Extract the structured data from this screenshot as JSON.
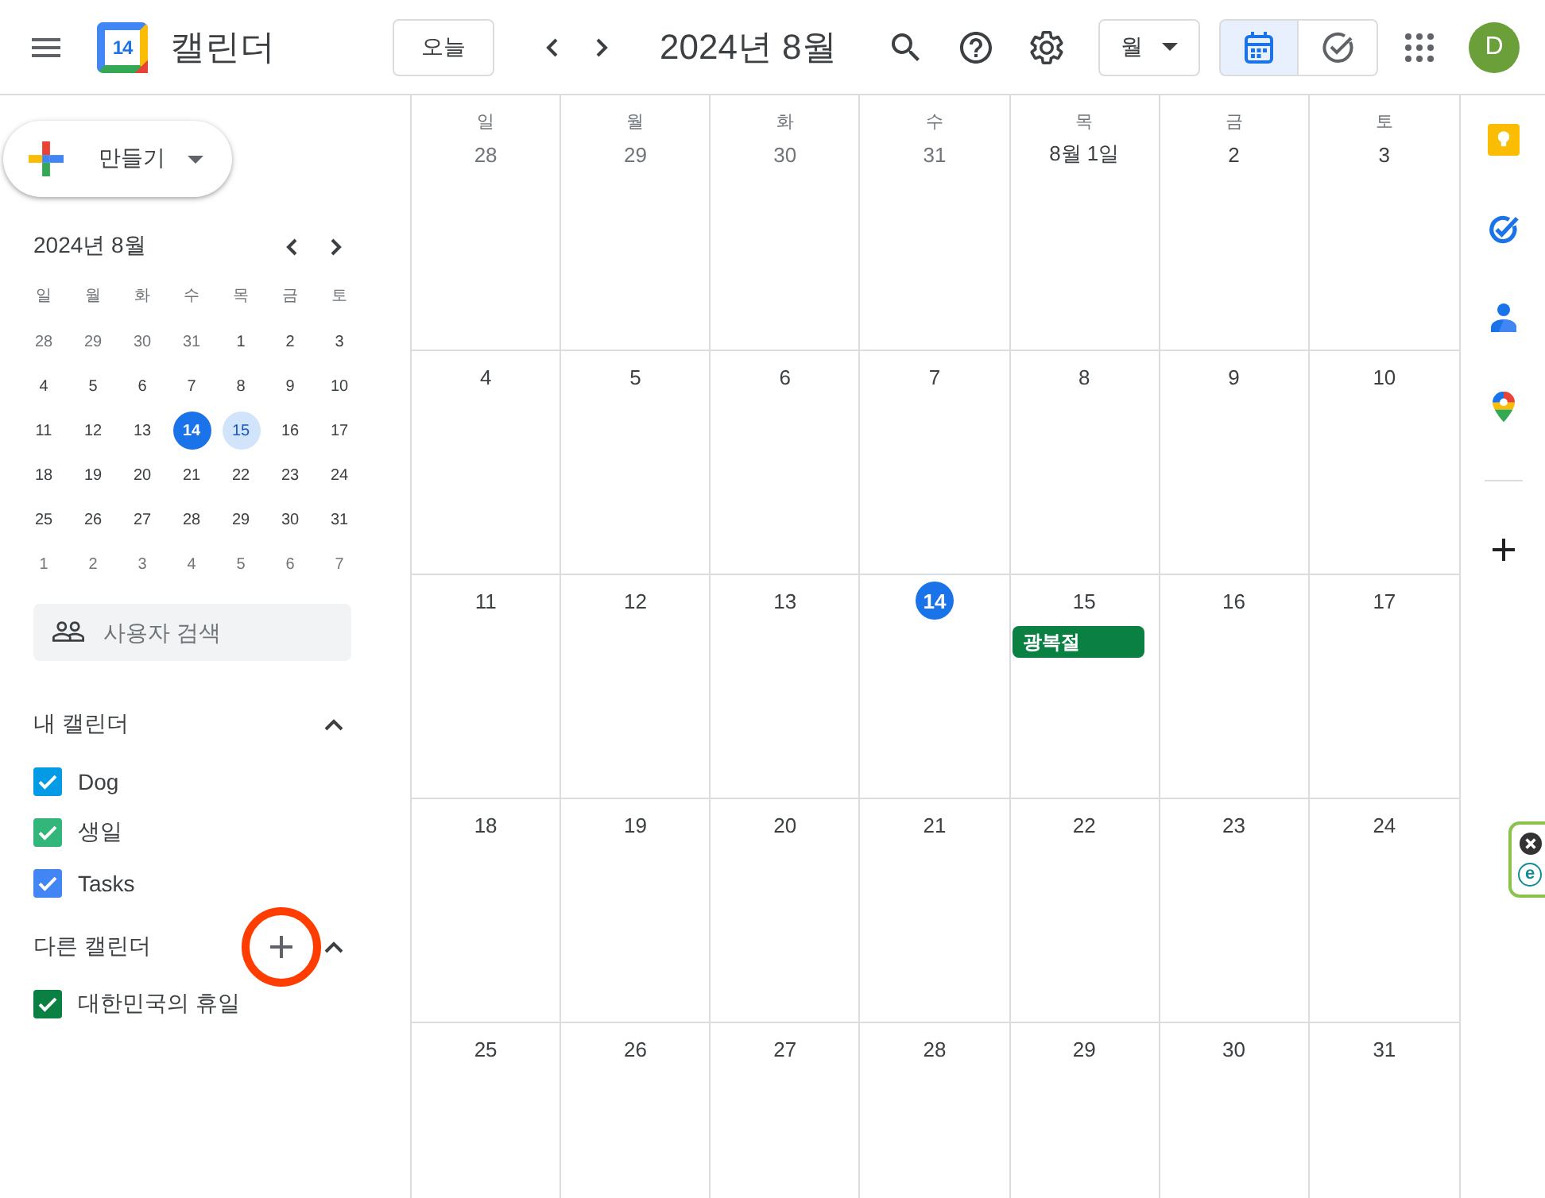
{
  "header": {
    "app_title": "캘린더",
    "logo_day": "14",
    "today_button": "오늘",
    "period_title": "2024년 8월",
    "view_select": "월",
    "view_toggle": [
      {
        "kind": "calendar",
        "selected": true
      },
      {
        "kind": "tasks",
        "selected": false
      }
    ],
    "avatar_initial": "D"
  },
  "sidebar": {
    "create_button": "만들기",
    "mini_calendar": {
      "title": "2024년 8월",
      "weekdays": [
        "일",
        "월",
        "화",
        "수",
        "목",
        "금",
        "토"
      ],
      "weeks": [
        [
          {
            "label": "28",
            "in_month": false,
            "today": false,
            "selected": false
          },
          {
            "label": "29",
            "in_month": false,
            "today": false,
            "selected": false
          },
          {
            "label": "30",
            "in_month": false,
            "today": false,
            "selected": false
          },
          {
            "label": "31",
            "in_month": false,
            "today": false,
            "selected": false
          },
          {
            "label": "1",
            "in_month": true,
            "today": false,
            "selected": false
          },
          {
            "label": "2",
            "in_month": true,
            "today": false,
            "selected": false
          },
          {
            "label": "3",
            "in_month": true,
            "today": false,
            "selected": false
          }
        ],
        [
          {
            "label": "4",
            "in_month": true,
            "today": false,
            "selected": false
          },
          {
            "label": "5",
            "in_month": true,
            "today": false,
            "selected": false
          },
          {
            "label": "6",
            "in_month": true,
            "today": false,
            "selected": false
          },
          {
            "label": "7",
            "in_month": true,
            "today": false,
            "selected": false
          },
          {
            "label": "8",
            "in_month": true,
            "today": false,
            "selected": false
          },
          {
            "label": "9",
            "in_month": true,
            "today": false,
            "selected": false
          },
          {
            "label": "10",
            "in_month": true,
            "today": false,
            "selected": false
          }
        ],
        [
          {
            "label": "11",
            "in_month": true,
            "today": false,
            "selected": false
          },
          {
            "label": "12",
            "in_month": true,
            "today": false,
            "selected": false
          },
          {
            "label": "13",
            "in_month": true,
            "today": false,
            "selected": false
          },
          {
            "label": "14",
            "in_month": true,
            "today": true,
            "selected": false
          },
          {
            "label": "15",
            "in_month": true,
            "today": false,
            "selected": true
          },
          {
            "label": "16",
            "in_month": true,
            "today": false,
            "selected": false
          },
          {
            "label": "17",
            "in_month": true,
            "today": false,
            "selected": false
          }
        ],
        [
          {
            "label": "18",
            "in_month": true,
            "today": false,
            "selected": false
          },
          {
            "label": "19",
            "in_month": true,
            "today": false,
            "selected": false
          },
          {
            "label": "20",
            "in_month": true,
            "today": false,
            "selected": false
          },
          {
            "label": "21",
            "in_month": true,
            "today": false,
            "selected": false
          },
          {
            "label": "22",
            "in_month": true,
            "today": false,
            "selected": false
          },
          {
            "label": "23",
            "in_month": true,
            "today": false,
            "selected": false
          },
          {
            "label": "24",
            "in_month": true,
            "today": false,
            "selected": false
          }
        ],
        [
          {
            "label": "25",
            "in_month": true,
            "today": false,
            "selected": false
          },
          {
            "label": "26",
            "in_month": true,
            "today": false,
            "selected": false
          },
          {
            "label": "27",
            "in_month": true,
            "today": false,
            "selected": false
          },
          {
            "label": "28",
            "in_month": true,
            "today": false,
            "selected": false
          },
          {
            "label": "29",
            "in_month": true,
            "today": false,
            "selected": false
          },
          {
            "label": "30",
            "in_month": true,
            "today": false,
            "selected": false
          },
          {
            "label": "31",
            "in_month": true,
            "today": false,
            "selected": false
          }
        ],
        [
          {
            "label": "1",
            "in_month": false,
            "today": false,
            "selected": false
          },
          {
            "label": "2",
            "in_month": false,
            "today": false,
            "selected": false
          },
          {
            "label": "3",
            "in_month": false,
            "today": false,
            "selected": false
          },
          {
            "label": "4",
            "in_month": false,
            "today": false,
            "selected": false
          },
          {
            "label": "5",
            "in_month": false,
            "today": false,
            "selected": false
          },
          {
            "label": "6",
            "in_month": false,
            "today": false,
            "selected": false
          },
          {
            "label": "7",
            "in_month": false,
            "today": false,
            "selected": false
          }
        ]
      ]
    },
    "people_search": {
      "placeholder": "사용자 검색"
    },
    "calendar_groups": [
      {
        "title": "내 캘린더",
        "expanded": true,
        "items": [
          {
            "label": "Dog",
            "checked": true,
            "color": "#039be5"
          },
          {
            "label": "생일",
            "checked": true,
            "color": "#33b679"
          },
          {
            "label": "Tasks",
            "checked": true,
            "color": "#4285f4"
          }
        ]
      },
      {
        "title": "다른 캘린더",
        "expanded": true,
        "can_add": true,
        "items": [
          {
            "label": "대한민국의 휴일",
            "checked": true,
            "color": "#0b8043"
          }
        ]
      }
    ]
  },
  "month_grid": {
    "weekdays": [
      "일",
      "월",
      "화",
      "수",
      "목",
      "금",
      "토"
    ],
    "weeks": [
      [
        {
          "label": "28",
          "in_month": false,
          "today": false
        },
        {
          "label": "29",
          "in_month": false,
          "today": false
        },
        {
          "label": "30",
          "in_month": false,
          "today": false
        },
        {
          "label": "31",
          "in_month": false,
          "today": false
        },
        {
          "label": "8월 1일",
          "in_month": true,
          "today": false
        },
        {
          "label": "2",
          "in_month": true,
          "today": false
        },
        {
          "label": "3",
          "in_month": true,
          "today": false
        }
      ],
      [
        {
          "label": "4",
          "in_month": true,
          "today": false
        },
        {
          "label": "5",
          "in_month": true,
          "today": false
        },
        {
          "label": "6",
          "in_month": true,
          "today": false
        },
        {
          "label": "7",
          "in_month": true,
          "today": false
        },
        {
          "label": "8",
          "in_month": true,
          "today": false
        },
        {
          "label": "9",
          "in_month": true,
          "today": false
        },
        {
          "label": "10",
          "in_month": true,
          "today": false
        }
      ],
      [
        {
          "label": "11",
          "in_month": true,
          "today": false
        },
        {
          "label": "12",
          "in_month": true,
          "today": false
        },
        {
          "label": "13",
          "in_month": true,
          "today": false
        },
        {
          "label": "14",
          "in_month": true,
          "today": true
        },
        {
          "label": "15",
          "in_month": true,
          "today": false,
          "events": [
            {
              "title": "광복절",
              "color": "#0b8043"
            }
          ]
        },
        {
          "label": "16",
          "in_month": true,
          "today": false
        },
        {
          "label": "17",
          "in_month": true,
          "today": false
        }
      ],
      [
        {
          "label": "18",
          "in_month": true,
          "today": false
        },
        {
          "label": "19",
          "in_month": true,
          "today": false
        },
        {
          "label": "20",
          "in_month": true,
          "today": false
        },
        {
          "label": "21",
          "in_month": true,
          "today": false
        },
        {
          "label": "22",
          "in_month": true,
          "today": false
        },
        {
          "label": "23",
          "in_month": true,
          "today": false
        },
        {
          "label": "24",
          "in_month": true,
          "today": false
        }
      ],
      [
        {
          "label": "25",
          "in_month": true,
          "today": false
        },
        {
          "label": "26",
          "in_month": true,
          "today": false
        },
        {
          "label": "27",
          "in_month": true,
          "today": false
        },
        {
          "label": "28",
          "in_month": true,
          "today": false
        },
        {
          "label": "29",
          "in_month": true,
          "today": false
        },
        {
          "label": "30",
          "in_month": true,
          "today": false
        },
        {
          "label": "31",
          "in_month": true,
          "today": false
        }
      ]
    ]
  },
  "extension_badge": {
    "logo": "e"
  }
}
